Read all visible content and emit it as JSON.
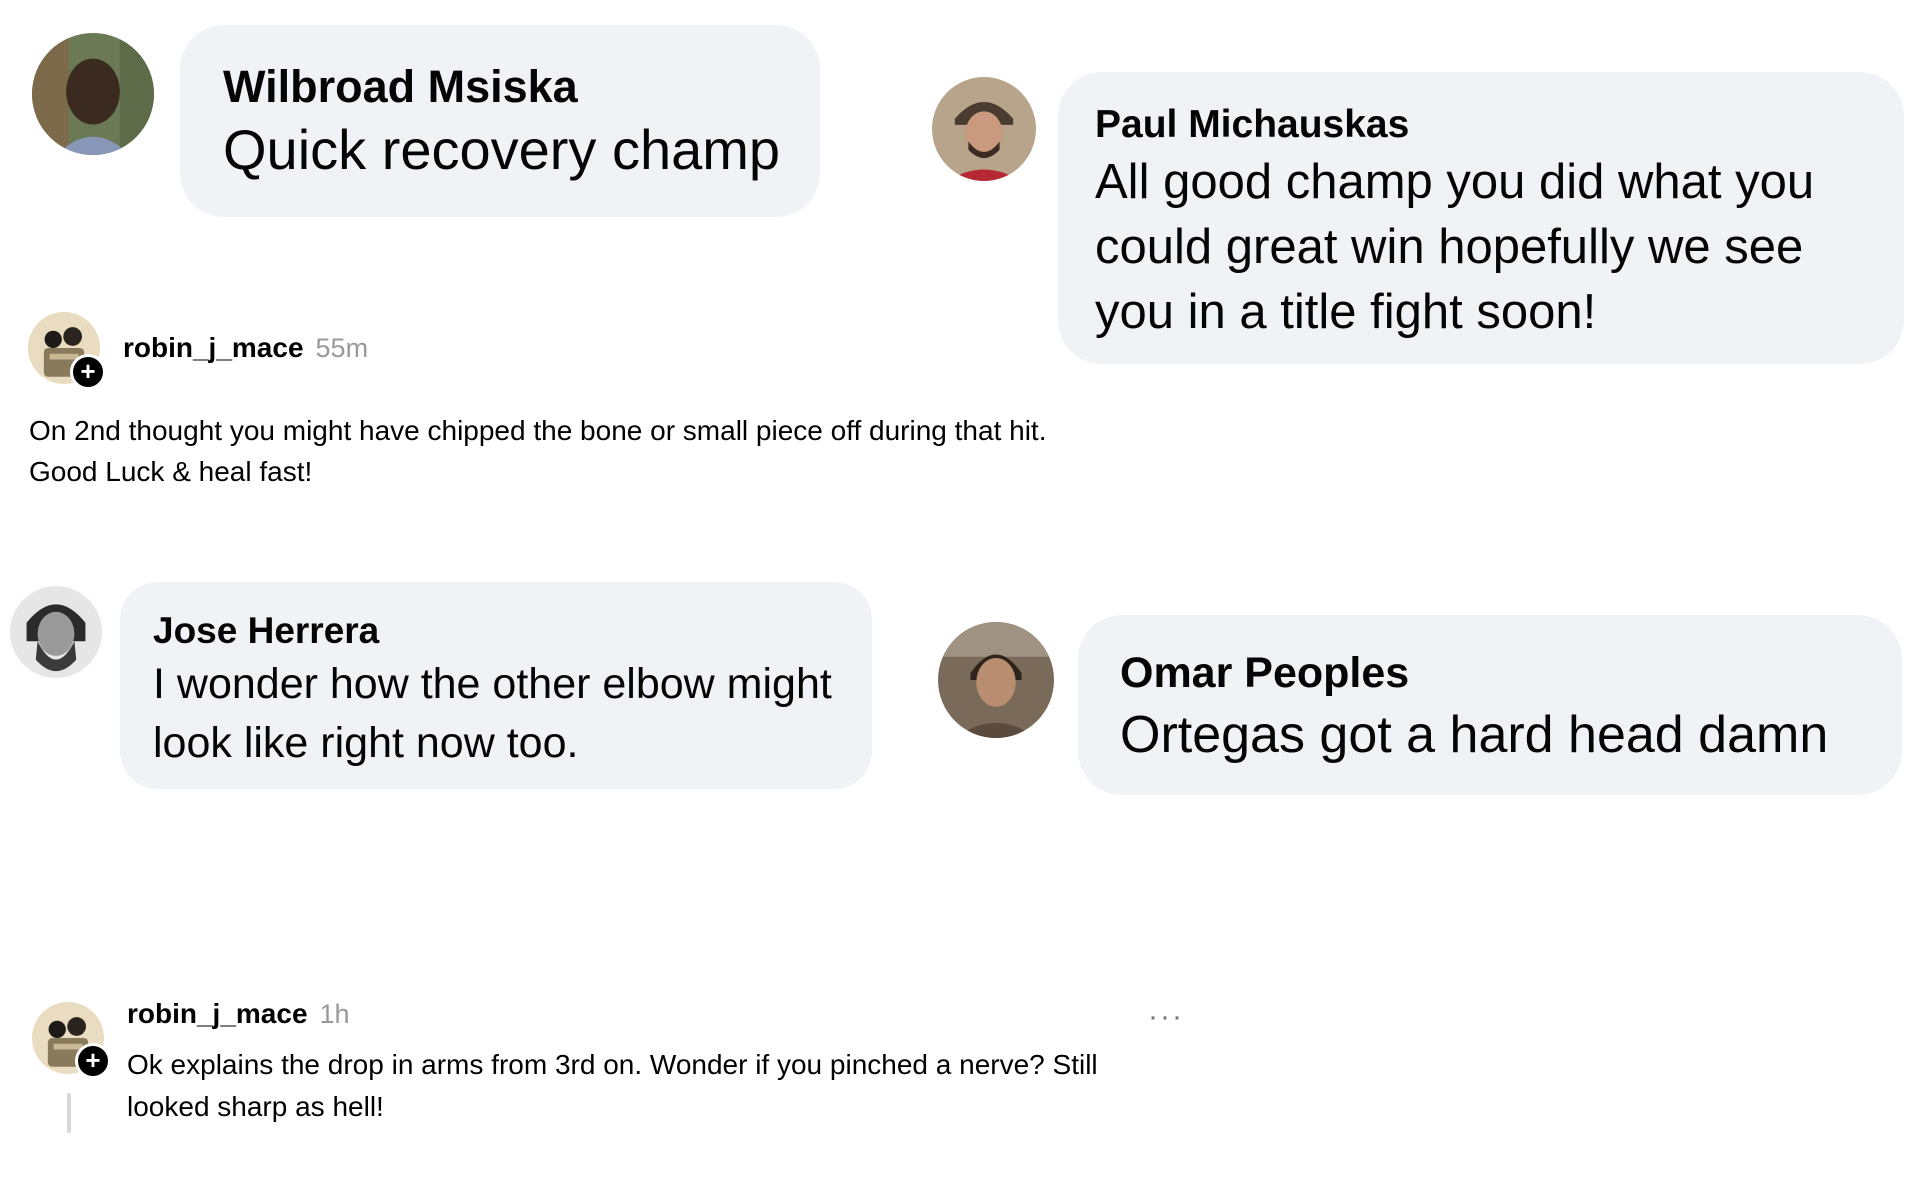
{
  "comments": [
    {
      "author": "Wilbroad Msiska",
      "text": "Quick recovery champ"
    },
    {
      "author": "Paul Michauskas",
      "text": "All good champ you did what you could great win hopefully we see you in a title fight soon!"
    },
    {
      "author": "Jose Herrera",
      "text": "I wonder how the other elbow might look like right now too."
    },
    {
      "author": "Omar Peoples",
      "text": "Ortegas got a hard head damn"
    }
  ],
  "posts": [
    {
      "username": "robin_j_mace",
      "time": "55m",
      "body": "On 2nd thought you might have chipped the bone or small piece off during that hit.\nGood Luck & heal fast!"
    },
    {
      "username": "robin_j_mace",
      "time": "1h",
      "body": "Ok explains the drop in arms from 3rd on. Wonder if you pinched a nerve? Still looked sharp as hell!"
    }
  ],
  "icons": {
    "plus": "+",
    "more": "···"
  },
  "colors": {
    "bubble_bg": "#f0f2f5",
    "timestamp": "#999999"
  }
}
